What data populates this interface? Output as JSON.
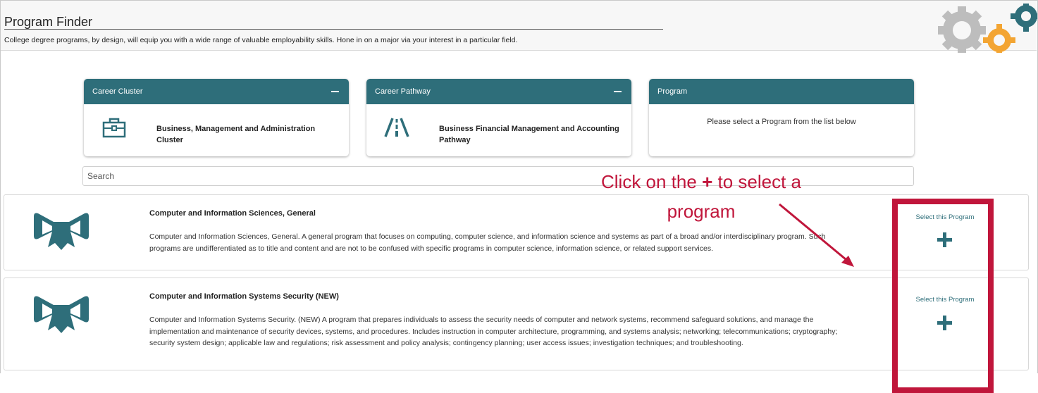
{
  "header": {
    "title": "Program Finder",
    "subtitle": "College degree programs, by design, will equip you with a wide range of valuable employability skills. Hone in on a major via your interest in a particular field."
  },
  "cards": [
    {
      "heading": "Career Cluster",
      "value": "Business, Management and Administration Cluster",
      "icon": "briefcase-icon"
    },
    {
      "heading": "Career Pathway",
      "value": "Business Financial Management and Accounting Pathway",
      "icon": "road-icon"
    },
    {
      "heading": "Program",
      "placeholder": "Please select a Program from the list below"
    }
  ],
  "search": {
    "placeholder": "Search"
  },
  "programs": [
    {
      "name": "Computer and Information Sciences, General",
      "description": "Computer and Information Sciences, General. A general program that focuses on computing, computer science, and information science and systems as part of a broad and/or interdisciplinary program. Such programs are undifferentiated as to title and content and are not to be confused with specific programs in computer science, information science, or related support services.",
      "select_label": "Select this Program",
      "icon": "diploma-ribbon-icon"
    },
    {
      "name": "Computer and Information Systems Security (NEW)",
      "description": "Computer and Information Systems Security. (NEW) A program that prepares individuals to assess the security needs of computer and network systems, recommend safeguard solutions, and manage the implementation and maintenance of security devices, systems, and procedures. Includes instruction in computer architecture, programming, and systems analysis; networking; telecommunications; cryptography; security system design; applicable law and regulations; risk assessment and policy analysis; contingency planning; user access issues; investigation techniques; and troubleshooting.",
      "select_label": "Select this Program",
      "icon": "diploma-ribbon-icon"
    }
  ],
  "annotation": {
    "line1_before": "Click on the ",
    "line1_plus": "+",
    "line1_after": " to select a",
    "line2": "program"
  },
  "colors": {
    "accent": "#2e6e7a",
    "annotation": "#c0163b"
  }
}
